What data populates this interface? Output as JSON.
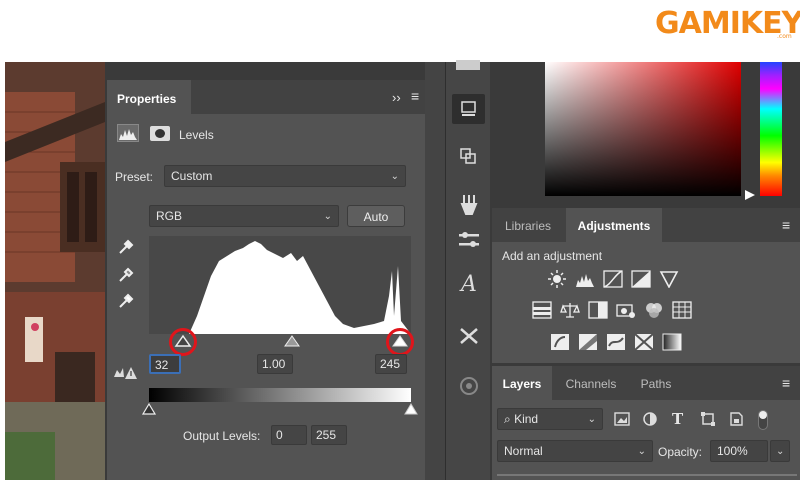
{
  "logo": {
    "text": "GAMIKEY",
    "sub": ".com"
  },
  "properties": {
    "tab": "Properties",
    "collapse": "››",
    "adjustment_name": "Levels",
    "preset_label": "Preset:",
    "preset_value": "Custom",
    "channel": "RGB",
    "auto_label": "Auto",
    "input_black": "32",
    "input_gamma": "1.00",
    "input_white": "245",
    "output_label": "Output Levels:",
    "output_black": "0",
    "output_white": "255"
  },
  "adjustments": {
    "tabs": [
      {
        "label": "Libraries",
        "active": false
      },
      {
        "label": "Adjustments",
        "active": true
      }
    ],
    "hint": "Add an adjustment"
  },
  "layers": {
    "tabs": [
      {
        "label": "Layers",
        "active": true
      },
      {
        "label": "Channels",
        "active": false
      },
      {
        "label": "Paths",
        "active": false
      }
    ],
    "filter_label": "Kind",
    "blend_mode": "Normal",
    "opacity_label": "Opacity:",
    "opacity_value": "100%"
  },
  "colors": {
    "panel": "#535353",
    "dark": "#3a3a3a",
    "accent_red": "#e0151b",
    "logo_orange": "#f28a1a"
  }
}
